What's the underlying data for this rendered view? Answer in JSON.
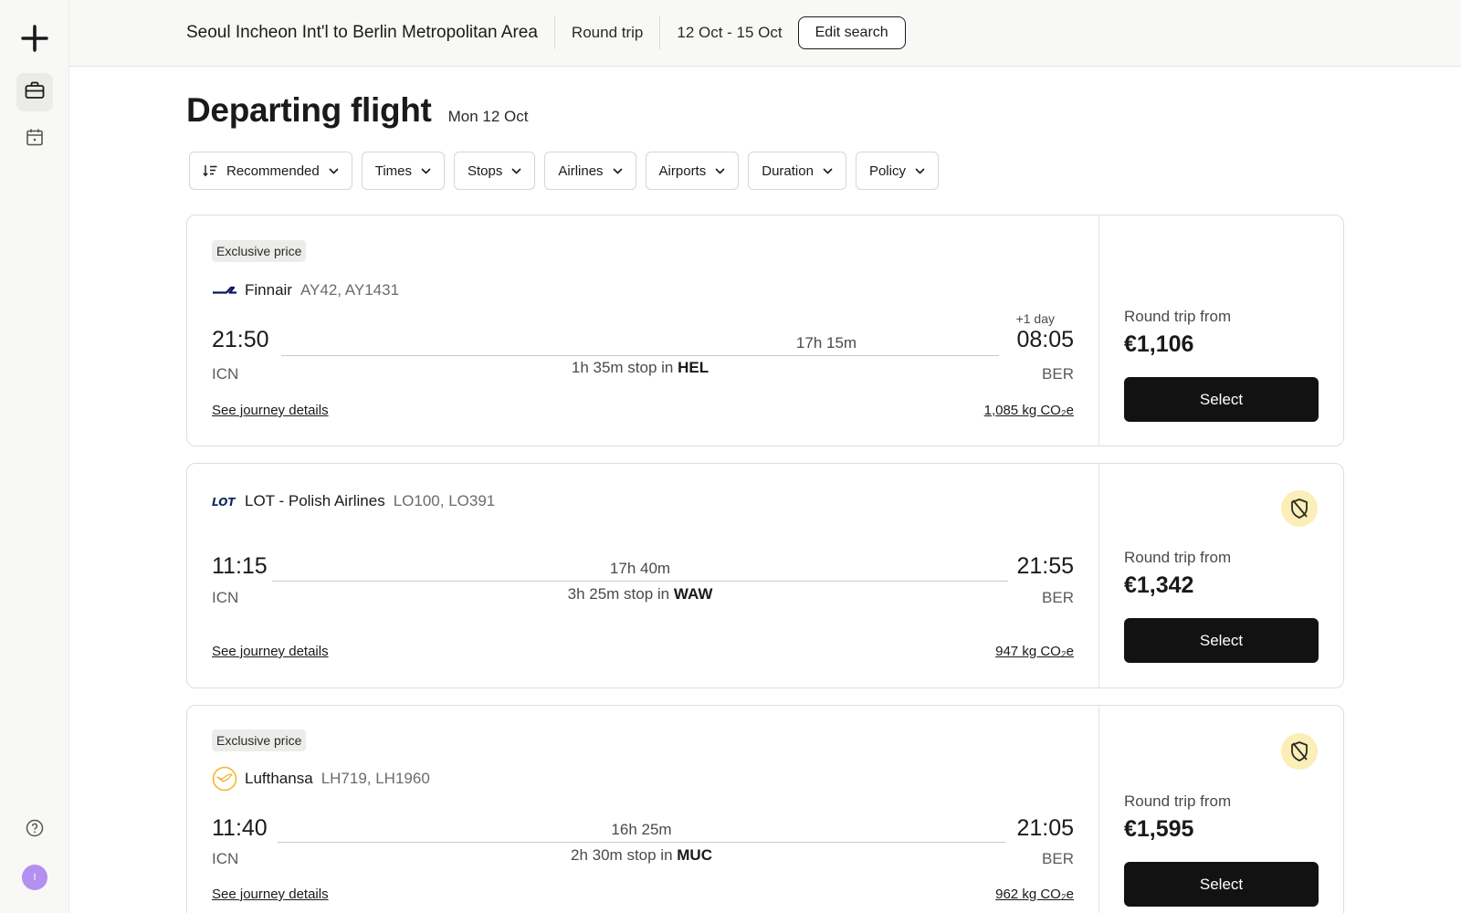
{
  "sidebar": {
    "logo_icon": "plane-icon",
    "items": [
      {
        "name": "trips",
        "icon": "briefcase-icon",
        "active": true
      },
      {
        "name": "calendar",
        "icon": "calendar-icon",
        "active": false
      }
    ],
    "help_icon": "help-icon",
    "avatar_initial": "I"
  },
  "header": {
    "route": "Seoul Incheon Int'l to Berlin Metropolitan Area",
    "trip_type": "Round trip",
    "dates": "12 Oct - 15 Oct",
    "edit_label": "Edit search"
  },
  "page": {
    "title": "Departing flight",
    "date": "Mon 12 Oct"
  },
  "filters": [
    {
      "label": "Recommended",
      "icon": "sort-icon"
    },
    {
      "label": "Times"
    },
    {
      "label": "Stops"
    },
    {
      "label": "Airlines"
    },
    {
      "label": "Airports"
    },
    {
      "label": "Duration"
    },
    {
      "label": "Policy"
    }
  ],
  "flights": [
    {
      "badge": "Exclusive price",
      "airline": "Finnair",
      "airline_icon": "finnair-logo-icon",
      "codes": "AY42, AY1431",
      "dep_time": "21:50",
      "dep_code": "ICN",
      "arr_time": "08:05",
      "arr_code": "BER",
      "plus_day": "+1 day",
      "duration": "17h 15m",
      "stop_prefix": "1h 35m stop in",
      "stop_airport": "HEL",
      "details_label": "See journey details",
      "co2": "1,085 kg CO₂e",
      "price_label": "Round trip from",
      "price": "€1,106",
      "select_label": "Select",
      "out_of_policy": false
    },
    {
      "badge": "",
      "airline": "LOT - Polish Airlines",
      "airline_icon": "lot-logo-icon",
      "codes": "LO100, LO391",
      "dep_time": "11:15",
      "dep_code": "ICN",
      "arr_time": "21:55",
      "arr_code": "BER",
      "plus_day": "",
      "duration": "17h 40m",
      "stop_prefix": "3h 25m stop in",
      "stop_airport": "WAW",
      "details_label": "See journey details",
      "co2": "947 kg CO₂e",
      "price_label": "Round trip from",
      "price": "€1,342",
      "select_label": "Select",
      "out_of_policy": true
    },
    {
      "badge": "Exclusive price",
      "airline": "Lufthansa",
      "airline_icon": "lufthansa-logo-icon",
      "codes": "LH719, LH1960",
      "dep_time": "11:40",
      "dep_code": "ICN",
      "arr_time": "21:05",
      "arr_code": "BER",
      "plus_day": "",
      "duration": "16h 25m",
      "stop_prefix": "2h 30m stop in",
      "stop_airport": "MUC",
      "details_label": "See journey details",
      "co2": "962 kg CO₂e",
      "price_label": "Round trip from",
      "price": "€1,595",
      "select_label": "Select",
      "out_of_policy": true
    }
  ],
  "colors": {
    "button_bg": "#121212",
    "badge_bg": "#ececea",
    "policy_warning_bg": "#fbeeb6",
    "avatar_bg": "#b28ff0"
  }
}
